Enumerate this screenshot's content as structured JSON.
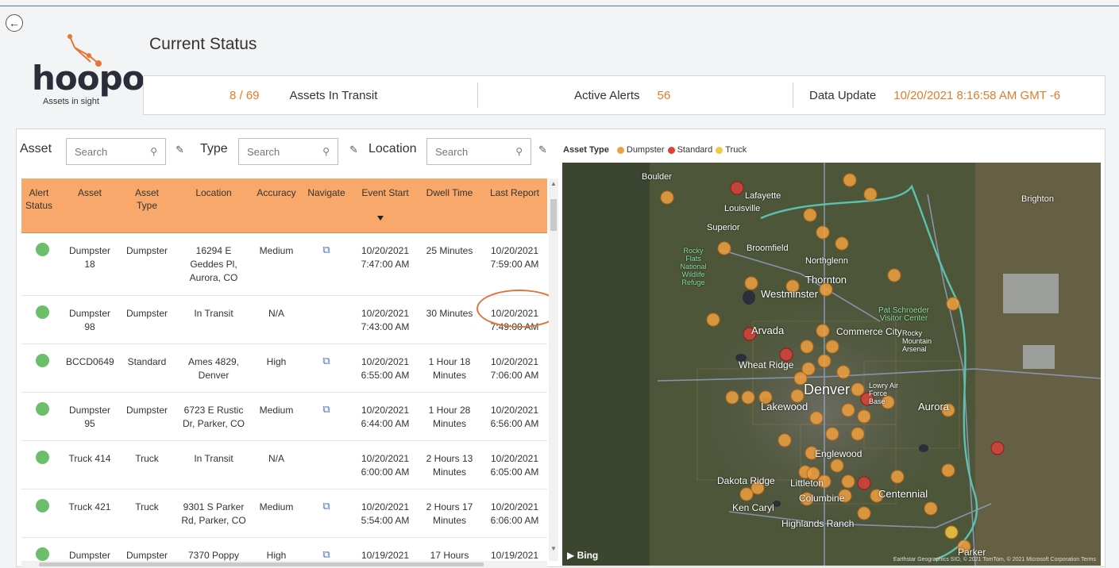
{
  "header": {
    "back_icon": "circle-arrow-left-icon",
    "logo_text": "hoopo",
    "logo_tagline": "Assets in sight",
    "page_title": "Current Status"
  },
  "status": {
    "in_transit_count": "8 / 69",
    "in_transit_label": "Assets In Transit",
    "alerts_label": "Active Alerts",
    "alerts_count": "56",
    "update_label": "Data Update",
    "update_value": "10/20/2021 8:16:58 AM GMT -6"
  },
  "filters": {
    "asset_label": "Asset",
    "type_label": "Type",
    "location_label": "Location",
    "search_placeholder": "Search"
  },
  "table": {
    "columns": [
      "Alert Status",
      "Asset",
      "Asset Type",
      "Location",
      "Accuracy",
      "Navigate",
      "Event Start",
      "Dwell Time",
      "Last Report"
    ],
    "rows": [
      {
        "asset": "Dumpster 18",
        "type": "Dumpster",
        "location": "16294 E Geddes Pl, Aurora, CO",
        "accuracy": "Medium",
        "navigate": true,
        "event_start": "10/20/2021 7:47:00 AM",
        "dwell": "25 Minutes",
        "last_report": "10/20/2021 7:59:00 AM"
      },
      {
        "asset": "Dumpster 98",
        "type": "Dumpster",
        "location": "In Transit",
        "accuracy": "N/A",
        "navigate": false,
        "event_start": "10/20/2021 7:43:00 AM",
        "dwell": "30 Minutes",
        "last_report": "10/20/2021 7:49:00 AM"
      },
      {
        "asset": "BCCD0649",
        "type": "Standard",
        "location": "Ames 4829, Denver",
        "accuracy": "High",
        "navigate": true,
        "event_start": "10/20/2021 6:55:00 AM",
        "dwell": "1 Hour 18 Minutes",
        "last_report": "10/20/2021 7:06:00 AM"
      },
      {
        "asset": "Dumpster 95",
        "type": "Dumpster",
        "location": "6723 E Rustic Dr, Parker, CO",
        "accuracy": "Medium",
        "navigate": true,
        "event_start": "10/20/2021 6:44:00 AM",
        "dwell": "1 Hour 28 Minutes",
        "last_report": "10/20/2021 6:56:00 AM"
      },
      {
        "asset": "Truck 414",
        "type": "Truck",
        "location": "In Transit",
        "accuracy": "N/A",
        "navigate": false,
        "event_start": "10/20/2021 6:00:00 AM",
        "dwell": "2 Hours 13 Minutes",
        "last_report": "10/20/2021 6:05:00 AM"
      },
      {
        "asset": "Truck 421",
        "type": "Truck",
        "location": "9301 S Parker Rd, Parker, CO",
        "accuracy": "Medium",
        "navigate": true,
        "event_start": "10/20/2021 5:54:00 AM",
        "dwell": "2 Hours 17 Minutes",
        "last_report": "10/20/2021 6:06:00 AM"
      },
      {
        "asset": "Dumpster",
        "type": "Dumpster",
        "location": "7370 Poppy",
        "accuracy": "High",
        "navigate": true,
        "event_start": "10/19/2021",
        "dwell": "17 Hours",
        "last_report": "10/19/2021"
      }
    ]
  },
  "legend": {
    "title": "Asset Type",
    "items": [
      {
        "label": "Dumpster",
        "color": "#f0a040"
      },
      {
        "label": "Standard",
        "color": "#d9413a"
      },
      {
        "label": "Truck",
        "color": "#f5c842"
      }
    ]
  },
  "map": {
    "labels": [
      "Boulder",
      "Lafayette",
      "Louisville",
      "Brighton",
      "Superior",
      "Broomfield",
      "Rocky Flats National Wildlife Refuge",
      "Northglenn",
      "Thornton",
      "Westminster",
      "Pat Schroeder Visitor Center",
      "Arvada",
      "Commerce City",
      "Rocky Mountain Arsenal",
      "Wheat Ridge",
      "Denver",
      "Lowry Air Force Base",
      "Aurora",
      "Lakewood",
      "Englewood",
      "Dakota Ridge",
      "Littleton",
      "Centennial",
      "Columbine",
      "Ken Caryl",
      "Highlands Ranch",
      "Parker"
    ],
    "attribution": "Bing",
    "copyright": "Earthstar Geographics SIO, © 2021 TomTom, © 2021 Microsoft Corporation Terms"
  },
  "colors": {
    "accent": "#e37b2a",
    "table_header": "#f8a86a",
    "status_green": "#6bbf6b",
    "highlight": "#e0753a"
  }
}
